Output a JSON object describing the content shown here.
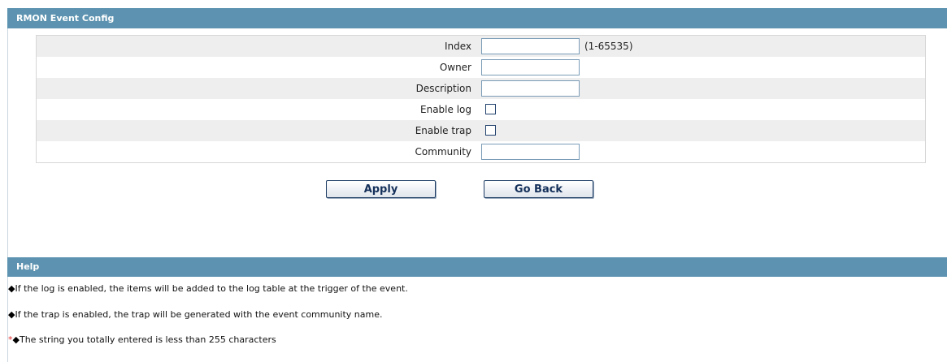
{
  "config": {
    "title": "RMON Event Config",
    "fields": [
      {
        "label": "Index",
        "value": "",
        "hint": "(1-65535)"
      },
      {
        "label": "Owner",
        "value": ""
      },
      {
        "label": "Description",
        "value": ""
      },
      {
        "label": "Enable log",
        "checked": false
      },
      {
        "label": "Enable trap",
        "checked": false
      },
      {
        "label": "Community",
        "value": ""
      }
    ],
    "apply_label": "Apply",
    "goback_label": "Go Back"
  },
  "help": {
    "title": "Help",
    "bullet": "◆",
    "star": "*",
    "lines": [
      "If the log is enabled, the items will be added to the log table at the trigger of the event.",
      "If the trap is enabled, the trap will be generated with the event community name.",
      "The string you totally entered is less than 255 characters"
    ]
  },
  "colors": {
    "header_bg": "#5d93b0",
    "row_alt_bg": "#eeeeee",
    "button_text": "#14305a",
    "required_star": "#e53030"
  }
}
